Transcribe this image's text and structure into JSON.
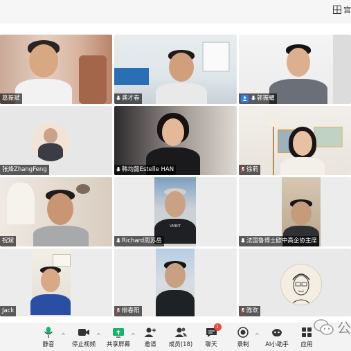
{
  "window": {
    "view_label": "宫"
  },
  "participants": [
    {
      "name": "葛振斌",
      "host": false,
      "muted": false
    },
    {
      "name": "龚才春",
      "host": false,
      "muted": false
    },
    {
      "name": "郭振耀",
      "host": true,
      "muted": false
    },
    {
      "name": "张烽ZhangFeng",
      "host": false,
      "muted": false
    },
    {
      "name": "韩均懿Estelle HAN",
      "host": false,
      "muted": false
    },
    {
      "name": "徐莉",
      "host": false,
      "muted": true
    },
    {
      "name": "祝斌",
      "host": false,
      "muted": false
    },
    {
      "name": "Richard周苏岳",
      "host": false,
      "muted": false
    },
    {
      "name": "法国鲁博士欧中高企协主席",
      "host": false,
      "muted": false
    },
    {
      "name": "Jack",
      "host": false,
      "muted": false
    },
    {
      "name": "柳春阳",
      "host": false,
      "muted": true
    },
    {
      "name": "陈欢",
      "host": false,
      "muted": true
    }
  ],
  "tile_scenes": {
    "t1": "VMBIT"
  },
  "toolbar": {
    "mute": "静音",
    "stop_video": "停止视频",
    "share_screen": "共享屏幕",
    "invite": "邀请",
    "members": "成员(18)",
    "chat": "聊天",
    "chat_badge": "1",
    "record": "录制",
    "ai_assistant": "AI小助手",
    "apps": "应用"
  },
  "watermark": "公",
  "colors": {
    "accent_green": "#15b36b",
    "badge_red": "#f04438",
    "host_blue": "#2e7df6"
  }
}
